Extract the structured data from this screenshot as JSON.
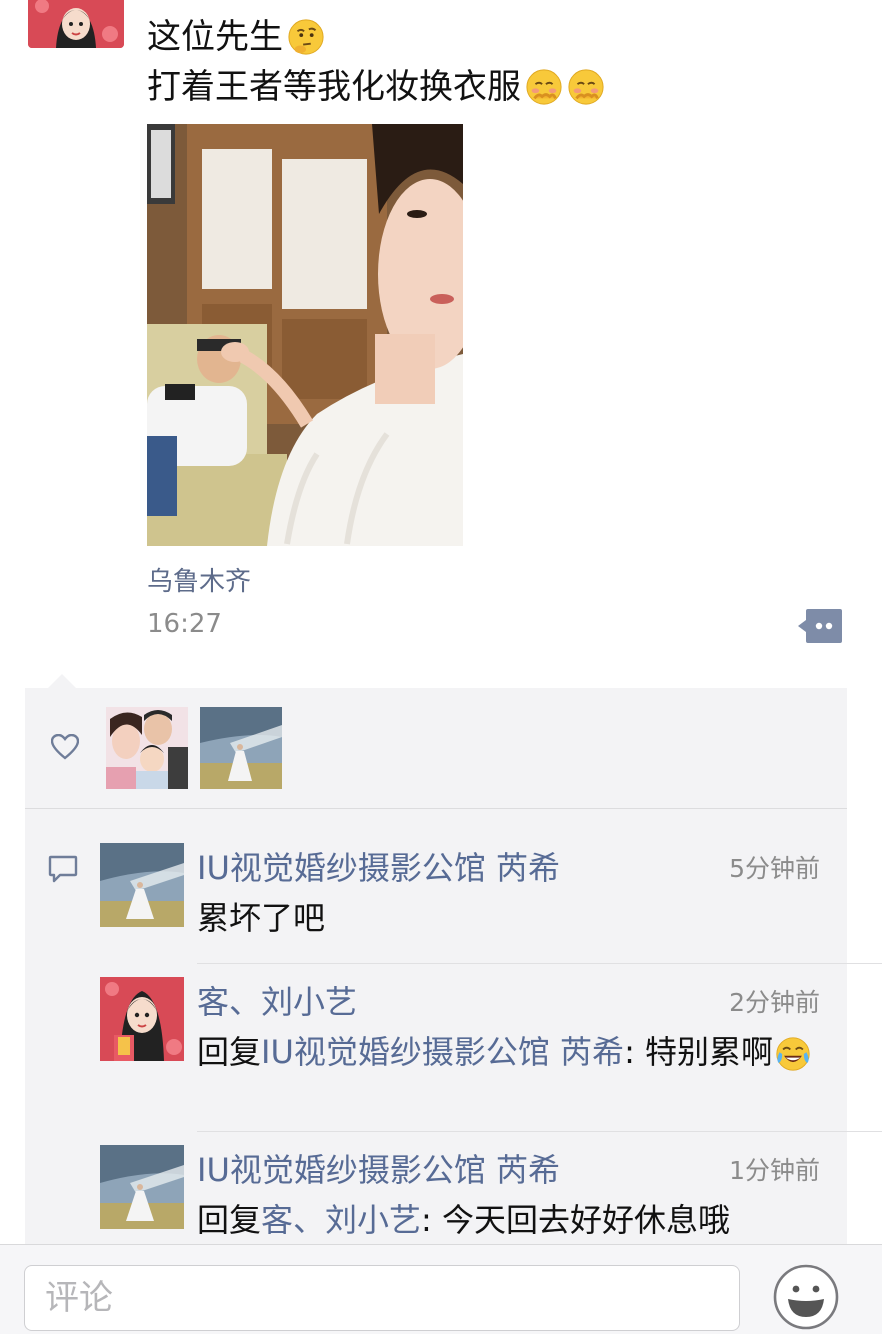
{
  "post": {
    "line1": "这位先生",
    "line2": "打着王者等我化妆换衣服",
    "location": "乌鲁木齐",
    "time": "16:27"
  },
  "comments": [
    {
      "name": "IU视觉婚纱摄影公馆  芮希",
      "time": "5分钟前",
      "body": "累坏了吧"
    },
    {
      "name": "客、刘小艺",
      "time": "2分钟前",
      "reply_prefix": "回复",
      "reply_to": "IU视觉婚纱摄影公馆  芮希",
      "reply_text": ": 特别累啊"
    },
    {
      "name": "IU视觉婚纱摄影公馆  芮希",
      "time": "1分钟前",
      "reply_prefix": "回复",
      "reply_to": "客、刘小艺",
      "reply_text": ": 今天回去好好休息哦"
    }
  ],
  "input": {
    "placeholder": "评论"
  },
  "colors": {
    "link": "#576b95",
    "panel": "#f3f3f5",
    "muted": "#8b8b8b"
  },
  "icons": [
    "thinking-emoji",
    "shy-emoji",
    "tears-of-joy-emoji",
    "heart-icon",
    "comment-icon",
    "more-icon",
    "smiley-icon"
  ]
}
